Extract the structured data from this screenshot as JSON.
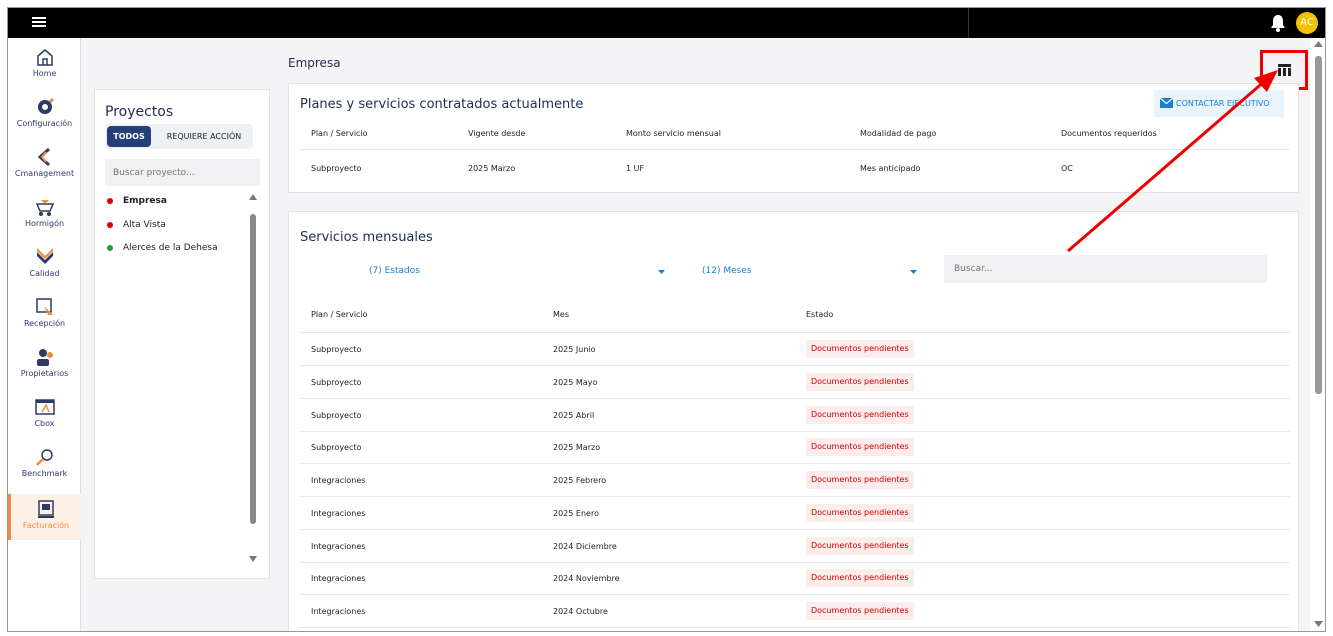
{
  "topbar": {
    "menu_icon": "hamburger-icon",
    "avatar_initials": "AC",
    "bell_icon": "bell-icon"
  },
  "sidenav": {
    "items": [
      {
        "label": "Home",
        "icon": "home-icon"
      },
      {
        "label": "Configuración",
        "icon": "gear-icon"
      },
      {
        "label": "Cmanagement",
        "icon": "cmanagement-icon"
      },
      {
        "label": "Hormigón",
        "icon": "concrete-mixer-icon"
      },
      {
        "label": "Calidad",
        "icon": "quality-check-icon"
      },
      {
        "label": "Recepción",
        "icon": "reception-icon"
      },
      {
        "label": "Propietarios",
        "icon": "owners-icon"
      },
      {
        "label": "Cbox",
        "icon": "cbox-icon"
      },
      {
        "label": "Benchmark",
        "icon": "benchmark-icon"
      },
      {
        "label": "Facturación",
        "icon": "billing-icon"
      }
    ],
    "active": "Facturación"
  },
  "projects": {
    "title": "Proyectos",
    "tabs": [
      "TODOS",
      "REQUIERE ACCIÓN"
    ],
    "search_placeholder": "Buscar proyecto...",
    "items": [
      {
        "name": "Empresa",
        "status_color": "#e00000"
      },
      {
        "name": "Alta Vista",
        "status_color": "#e00000"
      },
      {
        "name": "Alerces de la Dehesa",
        "status_color": "#1e9e3a"
      }
    ]
  },
  "page": {
    "title": "Empresa",
    "layout_icon": "table-layout-icon"
  },
  "plans": {
    "title": "Planes y servicios contratados actualmente",
    "contact_label": "CONTACTAR EJECUTIVO",
    "headers": [
      "Plan / Servicio",
      "Vigente desde",
      "Monto servicio mensual",
      "Modalidad de pago",
      "Documentos requeridos"
    ],
    "rows": [
      [
        "Subproyecto",
        "2025 Marzo",
        "1 UF",
        "Mes anticipado",
        "OC"
      ]
    ]
  },
  "services": {
    "title": "Servicios mensuales",
    "filter_estados": "(7) Estados",
    "filter_meses": "(12) Meses",
    "search_placeholder": "Buscar...",
    "headers": [
      "Plan / Servicio",
      "Mes",
      "Estado"
    ],
    "rows": [
      [
        "Subproyecto",
        "2025 Junio",
        "Documentos pendientes"
      ],
      [
        "Subproyecto",
        "2025 Mayo",
        "Documentos pendientes"
      ],
      [
        "Subproyecto",
        "2025 Abril",
        "Documentos pendientes"
      ],
      [
        "Subproyecto",
        "2025 Marzo",
        "Documentos pendientes"
      ],
      [
        "Integraciones",
        "2025 Febrero",
        "Documentos pendientes"
      ],
      [
        "Integraciones",
        "2025 Enero",
        "Documentos pendientes"
      ],
      [
        "Integraciones",
        "2024 Diciembre",
        "Documentos pendientes"
      ],
      [
        "Integraciones",
        "2024 Noviembre",
        "Documentos pendientes"
      ],
      [
        "Integraciones",
        "2024 Octubre",
        "Documentos pendientes"
      ]
    ]
  }
}
